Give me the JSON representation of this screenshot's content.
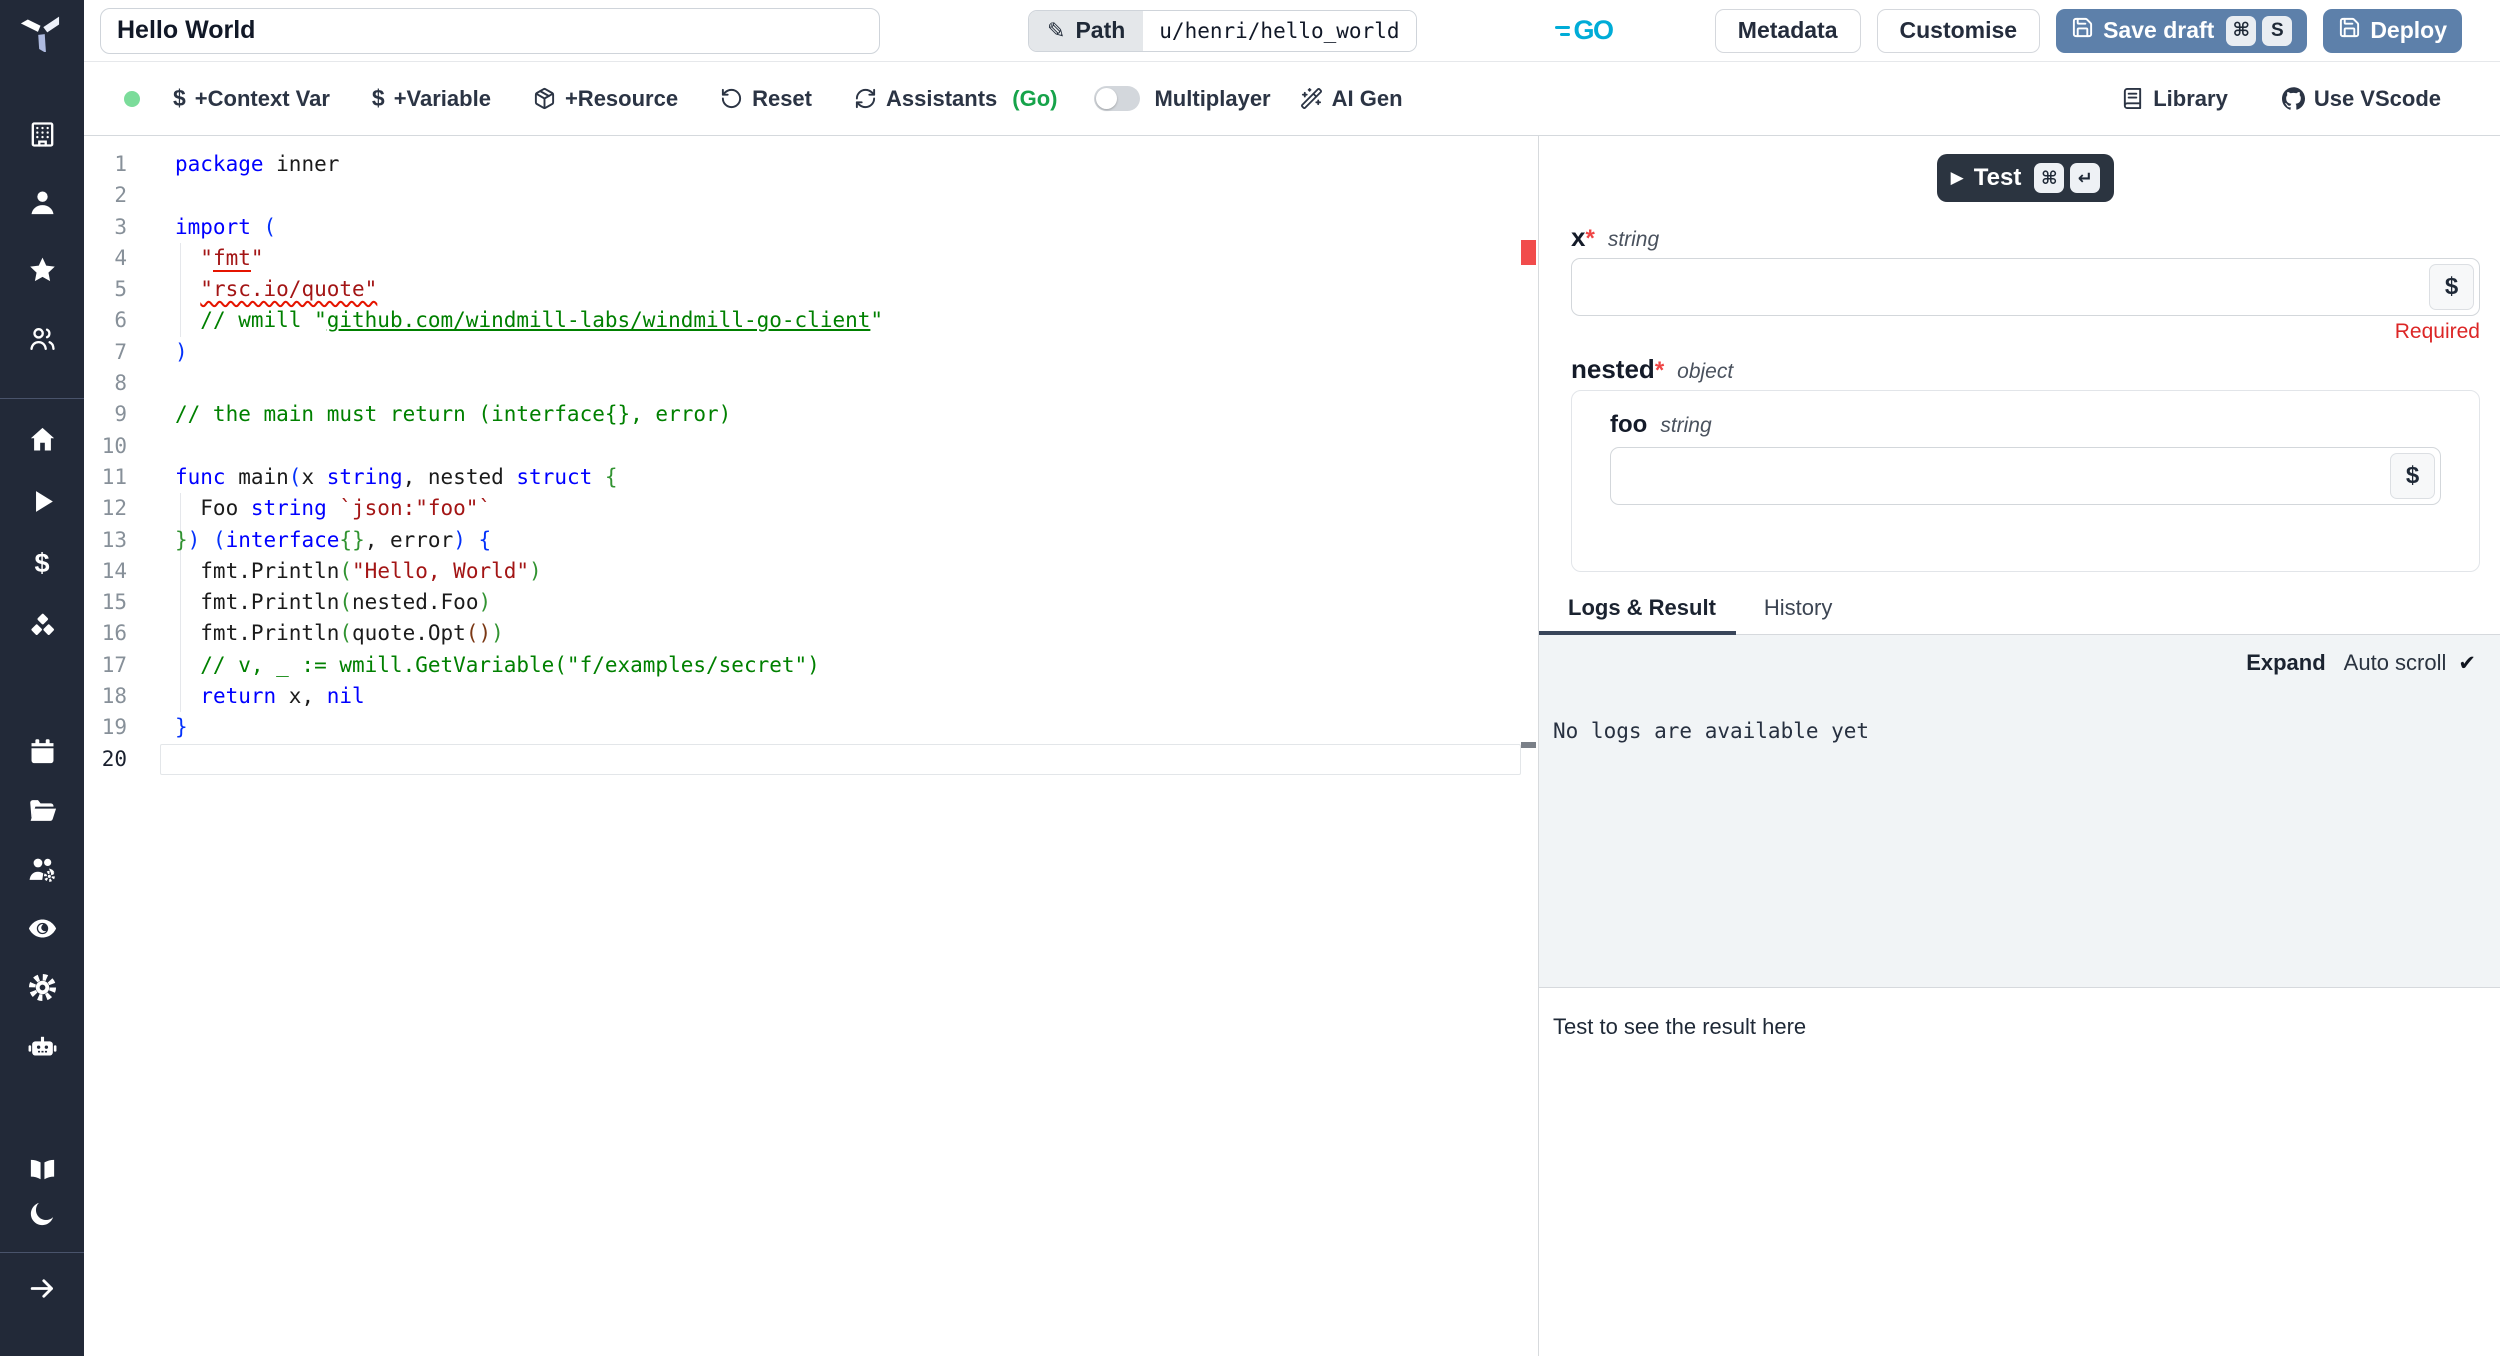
{
  "colors": {
    "sidebar_bg": "#222938",
    "accent_blue": "#5d80aa",
    "dark_button": "#2b3440",
    "go_cyan": "#00ACD7",
    "green": "#16a34a",
    "status_green": "#7bdc9a",
    "required_red": "#dc2626",
    "error_marker": "#f14c4c"
  },
  "sidebar": {
    "groups": [
      [
        {
          "icon": "building",
          "name": "workspace"
        },
        {
          "icon": "user",
          "name": "user"
        },
        {
          "icon": "star",
          "name": "favorites"
        },
        {
          "icon": "users",
          "name": "groups"
        }
      ],
      [
        {
          "icon": "home",
          "name": "home"
        },
        {
          "icon": "play",
          "name": "runs"
        },
        {
          "icon": "dollar",
          "name": "variables"
        },
        {
          "icon": "cubes",
          "name": "resources"
        }
      ],
      [
        {
          "icon": "calendar",
          "name": "schedules"
        },
        {
          "icon": "folder-open",
          "name": "folders"
        },
        {
          "icon": "users-cog",
          "name": "workers"
        },
        {
          "icon": "eye",
          "name": "audit-logs"
        },
        {
          "icon": "gear",
          "name": "settings"
        },
        {
          "icon": "bot",
          "name": "ai"
        }
      ],
      [
        {
          "icon": "book-open",
          "name": "docs"
        },
        {
          "icon": "moon",
          "name": "dark-mode"
        }
      ],
      [
        {
          "icon": "arrow-right",
          "name": "expand-sidebar"
        }
      ]
    ]
  },
  "topbar": {
    "title": "Hello World",
    "path_label": "Path",
    "path_value": "u/henri/hello_world",
    "pencil": "✎",
    "lang": "GO",
    "metadata_label": "Metadata",
    "customise_label": "Customise",
    "save_draft_label": "Save draft",
    "save_kbd": [
      "⌘",
      "S"
    ],
    "deploy_label": "Deploy"
  },
  "toolbar": {
    "items": [
      {
        "icon": "dollar-text",
        "label": "+Context Var"
      },
      {
        "icon": "dollar-text",
        "label": "+Variable"
      },
      {
        "icon": "package",
        "label": "+Resource"
      },
      {
        "icon": "rotate-ccw",
        "label": "Reset"
      },
      {
        "icon": "refresh-cw",
        "label": "Assistants",
        "suffix": "(Go)"
      }
    ],
    "multiplayer_label": "Multiplayer",
    "ai_gen_label": "AI Gen",
    "library_label": "Library",
    "vscode_label": "Use VScode"
  },
  "editor": {
    "active_line": 20,
    "lines": [
      {
        "n": 1,
        "segs": [
          [
            "k",
            "package"
          ],
          [
            "d",
            " inner"
          ]
        ]
      },
      {
        "n": 2,
        "segs": []
      },
      {
        "n": 3,
        "segs": [
          [
            "k",
            "import"
          ],
          [
            "d",
            " "
          ],
          [
            "b1",
            "("
          ]
        ]
      },
      {
        "n": 4,
        "segs": [
          [
            "d",
            "  "
          ],
          [
            "s",
            "\""
          ],
          [
            "se",
            "fmt"
          ],
          [
            "s",
            "\""
          ]
        ]
      },
      {
        "n": 5,
        "segs": [
          [
            "d",
            "  "
          ],
          [
            "sq",
            "\"rsc.io/quote\""
          ]
        ]
      },
      {
        "n": 6,
        "segs": [
          [
            "d",
            "  "
          ],
          [
            "c",
            "// wmill \""
          ],
          [
            "cl",
            "github.com/windmill-labs/windmill-go-client"
          ],
          [
            "c",
            "\""
          ]
        ]
      },
      {
        "n": 7,
        "segs": [
          [
            "b1",
            ")"
          ]
        ]
      },
      {
        "n": 8,
        "segs": []
      },
      {
        "n": 9,
        "segs": [
          [
            "c",
            "// the main must return (interface{}, error)"
          ]
        ]
      },
      {
        "n": 10,
        "segs": []
      },
      {
        "n": 11,
        "segs": [
          [
            "k",
            "func"
          ],
          [
            "d",
            " main"
          ],
          [
            "b1",
            "("
          ],
          [
            "d",
            "x "
          ],
          [
            "k",
            "string"
          ],
          [
            "d",
            ", nested "
          ],
          [
            "k",
            "struct"
          ],
          [
            "d",
            " "
          ],
          [
            "b2",
            "{"
          ]
        ]
      },
      {
        "n": 12,
        "segs": [
          [
            "d",
            "  Foo "
          ],
          [
            "k",
            "string"
          ],
          [
            "d",
            " "
          ],
          [
            "s",
            "`json:\"foo\"`"
          ]
        ]
      },
      {
        "n": 13,
        "segs": [
          [
            "b2",
            "}"
          ],
          [
            "b1",
            ")"
          ],
          [
            "d",
            " "
          ],
          [
            "b1",
            "("
          ],
          [
            "k",
            "interface"
          ],
          [
            "b2",
            "{}"
          ],
          [
            "d",
            ", error"
          ],
          [
            "b1",
            ")"
          ],
          [
            "d",
            " "
          ],
          [
            "b1",
            "{"
          ]
        ]
      },
      {
        "n": 14,
        "segs": [
          [
            "d",
            "  fmt.Println"
          ],
          [
            "b2",
            "("
          ],
          [
            "s",
            "\"Hello, World\""
          ],
          [
            "b2",
            ")"
          ]
        ]
      },
      {
        "n": 15,
        "segs": [
          [
            "d",
            "  fmt.Println"
          ],
          [
            "b2",
            "("
          ],
          [
            "d",
            "nested.Foo"
          ],
          [
            "b2",
            ")"
          ]
        ]
      },
      {
        "n": 16,
        "segs": [
          [
            "d",
            "  fmt.Println"
          ],
          [
            "b2",
            "("
          ],
          [
            "d",
            "quote.Opt"
          ],
          [
            "b3",
            "()"
          ],
          [
            "b2",
            ")"
          ]
        ]
      },
      {
        "n": 17,
        "segs": [
          [
            "c",
            "  // v, _ := wmill.GetVariable(\"f/examples/secret\")"
          ]
        ]
      },
      {
        "n": 18,
        "segs": [
          [
            "d",
            "  "
          ],
          [
            "k",
            "return"
          ],
          [
            "d",
            " x, "
          ],
          [
            "k",
            "nil"
          ]
        ]
      },
      {
        "n": 19,
        "segs": [
          [
            "b1",
            "}"
          ]
        ]
      },
      {
        "n": 20,
        "segs": []
      }
    ]
  },
  "run": {
    "test_label": "Test",
    "test_kbd": [
      "⌘",
      "↵"
    ],
    "play_glyph": "▶"
  },
  "args": {
    "x": {
      "name": "x",
      "star": "*",
      "type": "string",
      "value": "",
      "dollar": "$",
      "required_note": "Required"
    },
    "nested": {
      "name": "nested",
      "star": "*",
      "type": "object",
      "foo": {
        "name": "foo",
        "type": "string",
        "value": "",
        "dollar": "$"
      }
    }
  },
  "tabs": {
    "logs_label": "Logs & Result",
    "history_label": "History"
  },
  "logs": {
    "expand_label": "Expand",
    "autoscroll_label": "Auto scroll",
    "check_glyph": "✔",
    "empty_message": "No logs are available yet"
  },
  "result": {
    "placeholder": "Test to see the result here"
  }
}
